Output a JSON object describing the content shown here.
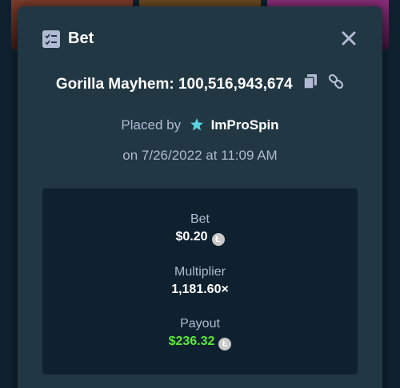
{
  "modal": {
    "title": "Bet",
    "game_name": "Gorilla Mayhem: 100,516,943,674",
    "placed_by_label": "Placed by",
    "username": "ImProSpin",
    "date_text": "on 7/26/2022 at 11:09 AM"
  },
  "stats": {
    "bet_label": "Bet",
    "bet_value": "$0.20",
    "multiplier_label": "Multiplier",
    "multiplier_value": "1,181.60×",
    "payout_label": "Payout",
    "payout_value": "$236.32",
    "currency_symbol": "Ł"
  },
  "icons": {
    "bet": "bet-slip-icon",
    "close": "close-icon",
    "copy": "copy-icon",
    "link": "link-icon",
    "user_rank": "star-badge-icon",
    "currency": "litecoin-icon"
  },
  "colors": {
    "modal_bg": "#213743",
    "stats_bg": "#0f212e",
    "payout_green": "#5ce83d",
    "muted_text": "#b1bad3",
    "rank_badge": "#5bd1e0"
  }
}
